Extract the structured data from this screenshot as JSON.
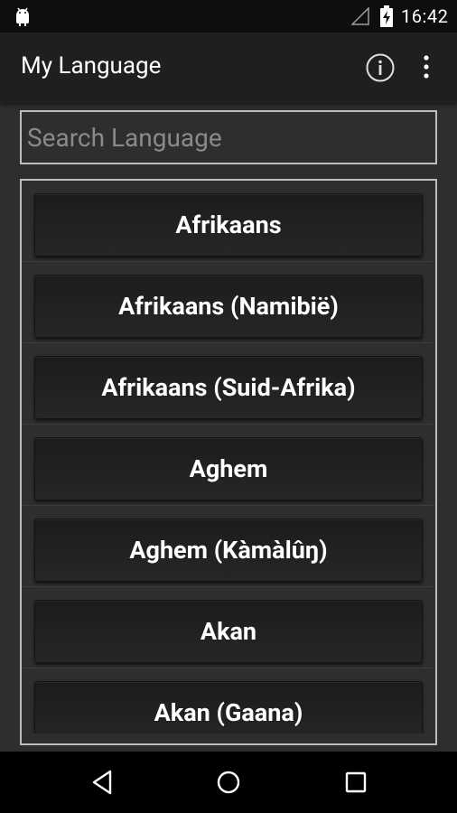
{
  "status_bar": {
    "time": "16:42"
  },
  "app_bar": {
    "title": "My Language"
  },
  "search": {
    "placeholder": "Search Language",
    "value": ""
  },
  "languages": [
    {
      "label": "Afrikaans"
    },
    {
      "label": "Afrikaans (Namibië)"
    },
    {
      "label": "Afrikaans (Suid-Afrika)"
    },
    {
      "label": "Aghem"
    },
    {
      "label": "Aghem (Kàmàlûŋ)"
    },
    {
      "label": "Akan"
    },
    {
      "label": "Akan (Gaana)"
    }
  ],
  "icons": {
    "status": [
      "android-icon",
      "signal-icon",
      "battery-charging-icon"
    ],
    "app_bar": [
      "info-icon",
      "overflow-menu-icon"
    ],
    "nav": [
      "back-icon",
      "home-icon",
      "recents-icon"
    ]
  }
}
